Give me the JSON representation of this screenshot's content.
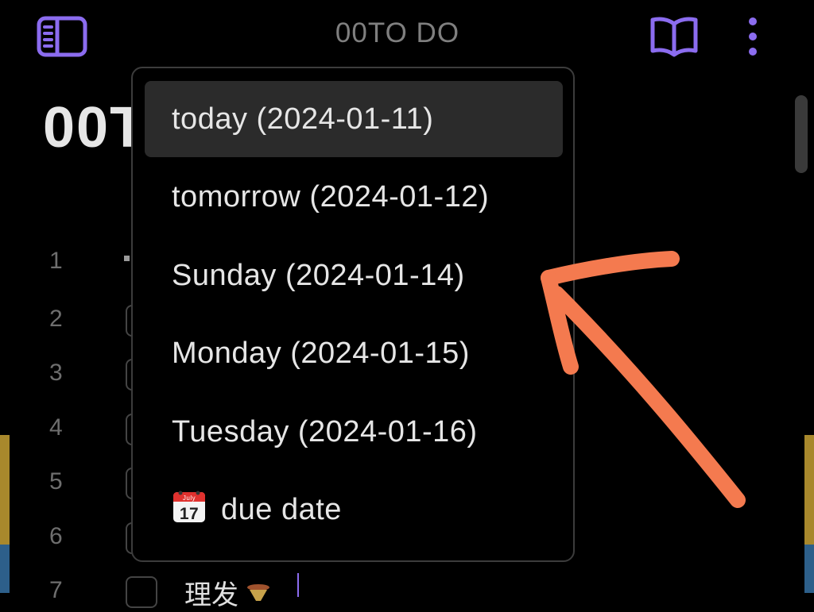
{
  "header": {
    "title": "00TO DO",
    "icons": {
      "left": "sidebar-toggle-icon",
      "right": [
        "book-open-icon",
        "more-vertical-icon"
      ]
    }
  },
  "editor": {
    "title_fragment": "00T",
    "line_numbers": [
      "1",
      "2",
      "3",
      "4",
      "5",
      "6",
      "7"
    ],
    "task_text": "理发"
  },
  "suggestions": {
    "items": [
      "today (2024-01-11)",
      "tomorrow (2024-01-12)",
      "Sunday (2024-01-14)",
      "Monday (2024-01-15)",
      "Tuesday (2024-01-16)"
    ],
    "due_date_label": "due date",
    "calendar_icon_text": {
      "month": "July",
      "day": "17"
    }
  },
  "colors": {
    "accent": "#8b6cef",
    "annotation": "#f47a4f",
    "selected_item_bg": "#2b2b2b"
  }
}
